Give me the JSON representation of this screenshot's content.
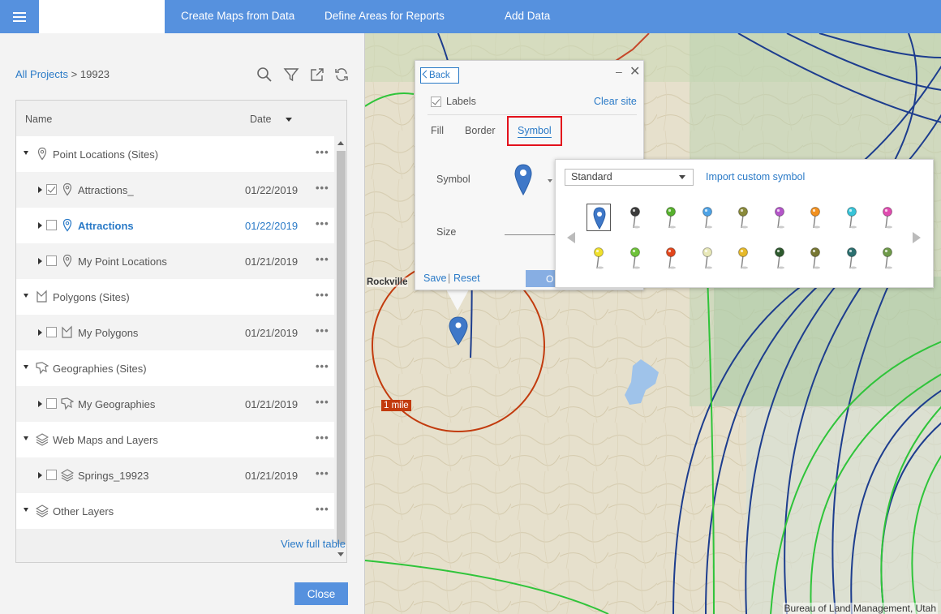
{
  "topbar": {
    "nav": [
      "Create Maps from Data",
      "Define Areas for Reports",
      "Add Data"
    ]
  },
  "breadcrumb": {
    "root": "All Projects",
    "separator": ">",
    "current": "19923"
  },
  "table": {
    "header_name": "Name",
    "header_date": "Date",
    "rows": [
      {
        "label": "Point Locations (Sites)",
        "date": "",
        "icon": "location-pin-icon"
      },
      {
        "label": "Attractions_",
        "date": "01/22/2019",
        "icon": "location-pin-icon",
        "checked": true
      },
      {
        "label": "Attractions",
        "date": "01/22/2019",
        "icon": "location-pin-icon",
        "checked": false
      },
      {
        "label": "My Point Locations",
        "date": "01/21/2019",
        "icon": "location-pin-icon",
        "checked": false
      },
      {
        "label": "Polygons (Sites)",
        "date": "",
        "icon": "polygon-icon"
      },
      {
        "label": "My Polygons",
        "date": "01/21/2019",
        "icon": "polygon-icon",
        "checked": false
      },
      {
        "label": "Geographies (Sites)",
        "date": "",
        "icon": "geography-icon"
      },
      {
        "label": "My Geographies",
        "date": "01/21/2019",
        "icon": "geography-icon",
        "checked": false
      },
      {
        "label": "Web Maps and Layers",
        "date": "",
        "icon": "layers-icon"
      },
      {
        "label": "Springs_19923",
        "date": "01/21/2019",
        "icon": "layers-icon",
        "checked": false
      },
      {
        "label": "Other Layers",
        "date": "",
        "icon": "layers-icon"
      }
    ],
    "more": "•••"
  },
  "view_full_table": "View full table",
  "close_label": "Close",
  "map": {
    "place_label": "Rockville",
    "radius_label": "1 mile",
    "attribution": "Bureau of Land Management, Utah"
  },
  "popup": {
    "back": "Back",
    "minimize": "–",
    "close": "✕",
    "labels": "Labels",
    "clear_site": "Clear site",
    "tabs": [
      "Fill",
      "Border",
      "Symbol"
    ],
    "symbol_label": "Symbol",
    "size_label": "Size",
    "save": "Save",
    "pipe": "|",
    "reset": "Reset",
    "ok": "O"
  },
  "gallery": {
    "selected_set": "Standard",
    "import": "Import custom symbol",
    "symbols": [
      "#3f78c8",
      "#3b3b3b",
      "#57b12e",
      "#4ea3e6",
      "#8a8a3a",
      "#b455c9",
      "#f2901e",
      "#38c4d8",
      "#e04cb0",
      "#f0e02c",
      "#6ec23a",
      "#e2461c",
      "#e8e8b8",
      "#e6b92a",
      "#2e5a2e",
      "#777733",
      "#2b6f6f",
      "#6f9a4a"
    ]
  }
}
